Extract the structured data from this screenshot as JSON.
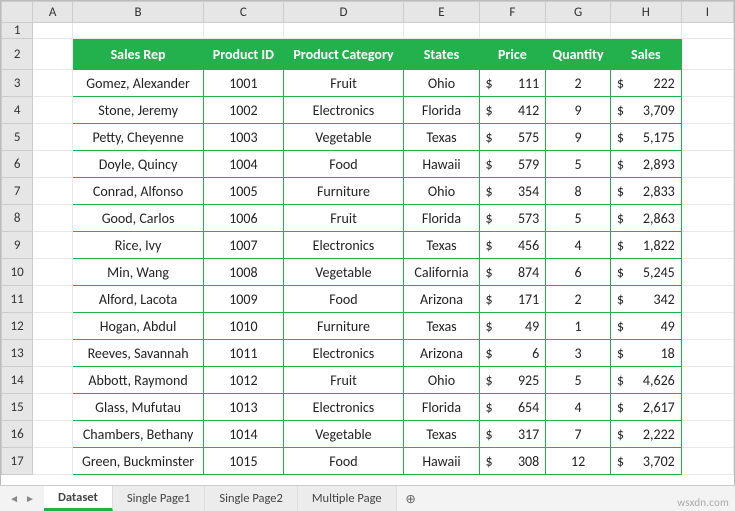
{
  "columns": [
    "A",
    "B",
    "C",
    "D",
    "E",
    "F",
    "G",
    "H",
    "I"
  ],
  "row_start": 1,
  "row_end": 17,
  "headers": {
    "sales_rep": "Sales Rep",
    "product_id": "Product ID",
    "product_category": "Product Category",
    "states": "States",
    "price": "Price",
    "quantity": "Quantity",
    "sales": "Sales"
  },
  "currency": "$",
  "rows": [
    {
      "sales_rep": "Gomez, Alexander",
      "product_id": "1001",
      "product_category": "Fruit",
      "states": "Ohio",
      "price": "111",
      "quantity": "2",
      "sales": "222"
    },
    {
      "sales_rep": "Stone, Jeremy",
      "product_id": "1002",
      "product_category": "Electronics",
      "states": "Florida",
      "price": "412",
      "quantity": "9",
      "sales": "3,709"
    },
    {
      "sales_rep": "Petty, Cheyenne",
      "product_id": "1003",
      "product_category": "Vegetable",
      "states": "Texas",
      "price": "575",
      "quantity": "9",
      "sales": "5,175"
    },
    {
      "sales_rep": "Doyle, Quincy",
      "product_id": "1004",
      "product_category": "Food",
      "states": "Hawaii",
      "price": "579",
      "quantity": "5",
      "sales": "2,893"
    },
    {
      "sales_rep": "Conrad, Alfonso",
      "product_id": "1005",
      "product_category": "Furniture",
      "states": "Ohio",
      "price": "354",
      "quantity": "8",
      "sales": "2,833"
    },
    {
      "sales_rep": "Good, Carlos",
      "product_id": "1006",
      "product_category": "Fruit",
      "states": "Florida",
      "price": "573",
      "quantity": "5",
      "sales": "2,863"
    },
    {
      "sales_rep": "Rice, Ivy",
      "product_id": "1007",
      "product_category": "Electronics",
      "states": "Texas",
      "price": "456",
      "quantity": "4",
      "sales": "1,822"
    },
    {
      "sales_rep": "Min, Wang",
      "product_id": "1008",
      "product_category": "Vegetable",
      "states": "California",
      "price": "874",
      "quantity": "6",
      "sales": "5,245"
    },
    {
      "sales_rep": "Alford, Lacota",
      "product_id": "1009",
      "product_category": "Food",
      "states": "Arizona",
      "price": "171",
      "quantity": "2",
      "sales": "342"
    },
    {
      "sales_rep": "Hogan, Abdul",
      "product_id": "1010",
      "product_category": "Furniture",
      "states": "Texas",
      "price": "49",
      "quantity": "1",
      "sales": "49"
    },
    {
      "sales_rep": "Reeves, Savannah",
      "product_id": "1011",
      "product_category": "Electronics",
      "states": "Arizona",
      "price": "6",
      "quantity": "3",
      "sales": "18"
    },
    {
      "sales_rep": "Abbott, Raymond",
      "product_id": "1012",
      "product_category": "Fruit",
      "states": "Ohio",
      "price": "925",
      "quantity": "5",
      "sales": "4,626"
    },
    {
      "sales_rep": "Glass, Mufutau",
      "product_id": "1013",
      "product_category": "Electronics",
      "states": "Florida",
      "price": "654",
      "quantity": "4",
      "sales": "2,617"
    },
    {
      "sales_rep": "Chambers, Bethany",
      "product_id": "1014",
      "product_category": "Vegetable",
      "states": "Texas",
      "price": "317",
      "quantity": "7",
      "sales": "2,222"
    },
    {
      "sales_rep": "Green, Buckminster",
      "product_id": "1015",
      "product_category": "Food",
      "states": "Hawaii",
      "price": "308",
      "quantity": "12",
      "sales": "3,702"
    }
  ],
  "tabs": [
    {
      "label": "Dataset",
      "active": true
    },
    {
      "label": "Single Page1",
      "active": false
    },
    {
      "label": "Single Page2",
      "active": false
    },
    {
      "label": "Multiple Page",
      "active": false
    }
  ],
  "watermark": "wsxdn.com"
}
